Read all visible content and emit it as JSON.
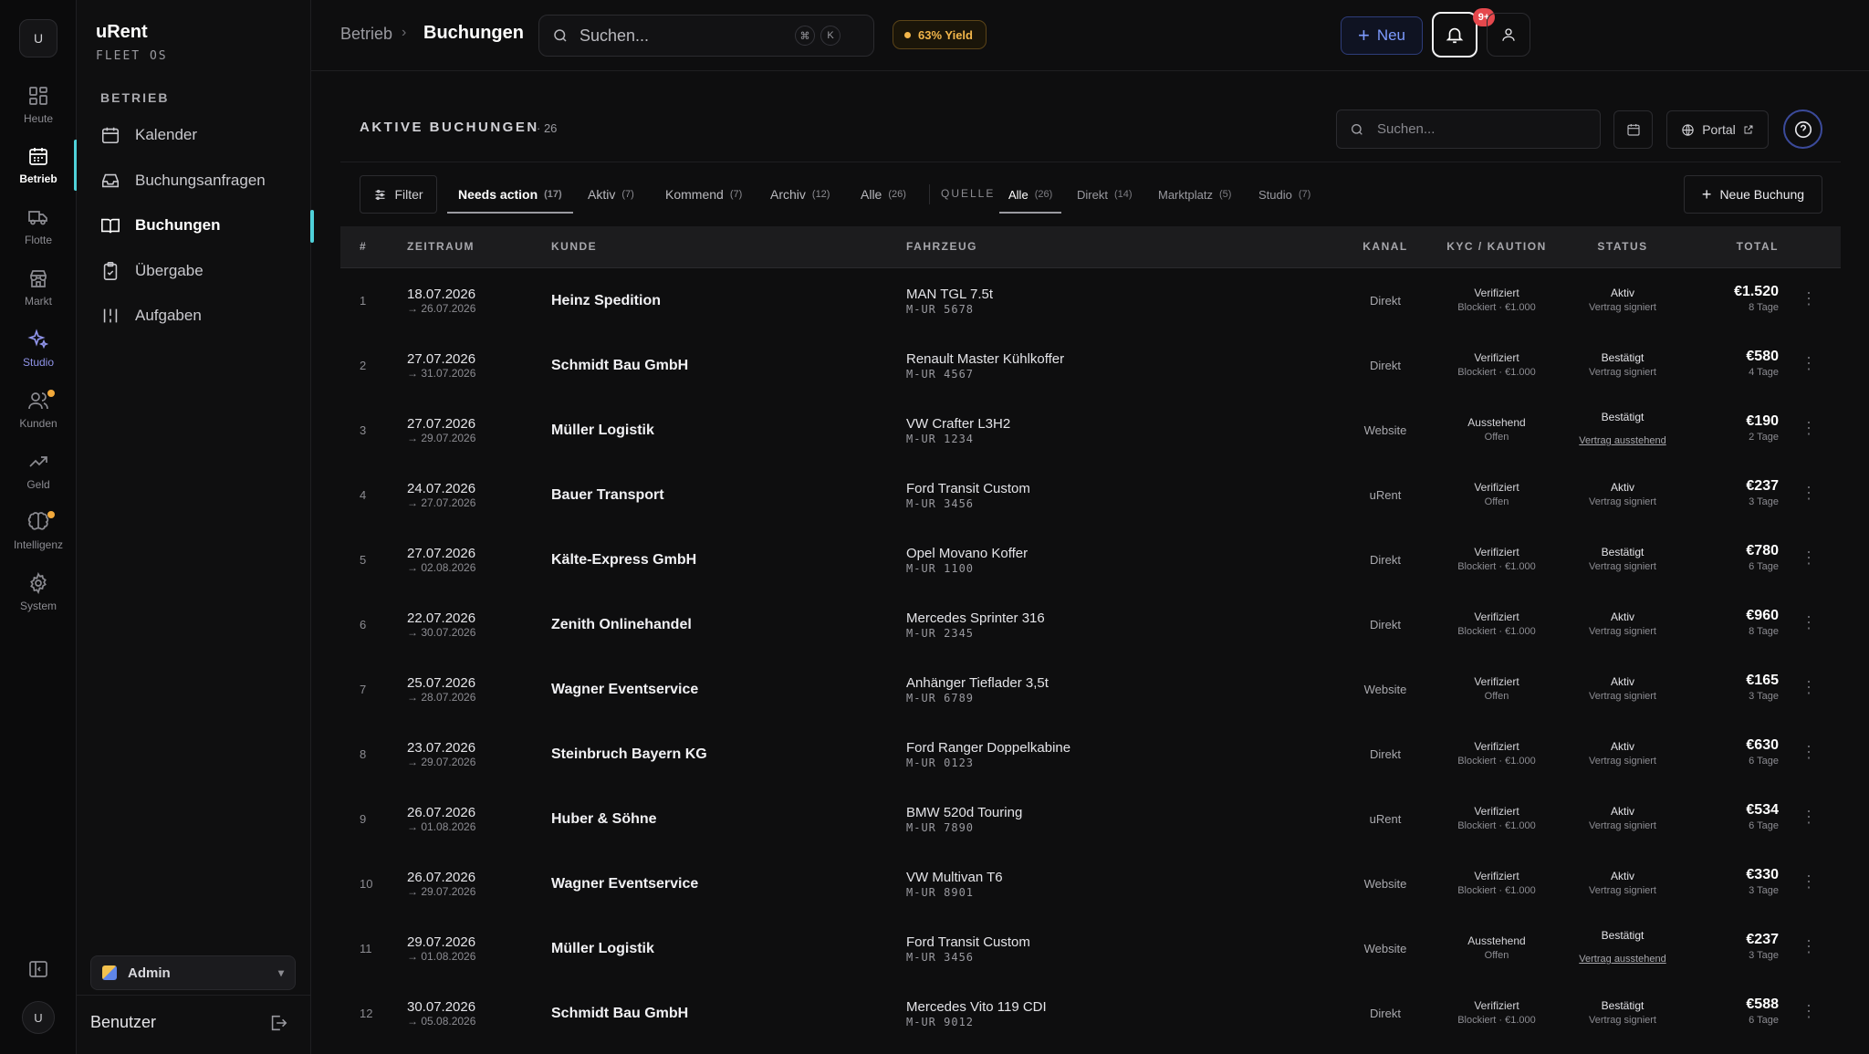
{
  "rail": {
    "top_avatar": "U",
    "items": [
      {
        "label": "Heute",
        "icon": "dashboard-icon"
      },
      {
        "label": "Betrieb",
        "icon": "calendar-icon"
      },
      {
        "label": "Flotte",
        "icon": "truck-icon"
      },
      {
        "label": "Markt",
        "icon": "store-icon"
      },
      {
        "label": "Studio",
        "icon": "sparkles-icon"
      },
      {
        "label": "Kunden",
        "icon": "users-icon"
      },
      {
        "label": "Geld",
        "icon": "trending-up-icon"
      },
      {
        "label": "Intelligenz",
        "icon": "brain-icon"
      },
      {
        "label": "System",
        "icon": "gear-icon"
      }
    ],
    "bottom_avatar": "U"
  },
  "sidebar": {
    "brand": "uRent",
    "brand_sub": "FLEET OS",
    "section": "BETRIEB",
    "items": [
      {
        "label": "Kalender"
      },
      {
        "label": "Buchungsanfragen"
      },
      {
        "label": "Buchungen"
      },
      {
        "label": "Übergabe"
      },
      {
        "label": "Aufgaben"
      }
    ],
    "role": "Admin",
    "user_label": "Benutzer"
  },
  "topbar": {
    "breadcrumb_parent": "Betrieb",
    "breadcrumb_current": "Buchungen",
    "search_placeholder": "Suchen...",
    "kbd1": "⌘",
    "kbd2": "K",
    "yield": "63% Yield",
    "new_label": "Neu",
    "notif_count": "9+"
  },
  "panel": {
    "title": "AKTIVE BUCHUNGEN",
    "count": "· 26",
    "search_placeholder": "Suchen...",
    "portal_label": "Portal"
  },
  "filters": {
    "filter_label": "Filter",
    "tabs": [
      {
        "label": "Needs action",
        "count": "(17)"
      },
      {
        "label": "Aktiv",
        "count": "(7)"
      },
      {
        "label": "Kommend",
        "count": "(7)"
      },
      {
        "label": "Archiv",
        "count": "(12)"
      },
      {
        "label": "Alle",
        "count": "(26)"
      }
    ],
    "source_label": "QUELLE",
    "sources": [
      {
        "label": "Alle",
        "count": "(26)"
      },
      {
        "label": "Direkt",
        "count": "(14)"
      },
      {
        "label": "Marktplatz",
        "count": "(5)"
      },
      {
        "label": "Studio",
        "count": "(7)"
      }
    ],
    "new_booking_label": "Neue Buchung"
  },
  "table": {
    "headers": [
      "#",
      "ZEITRAUM",
      "KUNDE",
      "FAHRZEUG",
      "KANAL",
      "KYC / KAUTION",
      "STATUS",
      "TOTAL"
    ],
    "rows": [
      {
        "num": "1",
        "from": "18.07.2026",
        "to": "→ 26.07.2026",
        "customer": "Heinz Spedition",
        "vehicle": "MAN TGL 7.5t",
        "plate": "M-UR 5678",
        "channel": "Direkt",
        "kyc": "Verifiziert",
        "deposit": "Blockiert · €1.000",
        "status": "Aktiv",
        "contract": "Vertrag signiert",
        "total": "€1.520",
        "days": "8 Tage"
      },
      {
        "num": "2",
        "from": "27.07.2026",
        "to": "→ 31.07.2026",
        "customer": "Schmidt Bau GmbH",
        "vehicle": "Renault Master Kühlkoffer",
        "plate": "M-UR 4567",
        "channel": "Direkt",
        "kyc": "Verifiziert",
        "deposit": "Blockiert · €1.000",
        "status": "Bestätigt",
        "contract": "Vertrag signiert",
        "total": "€580",
        "days": "4 Tage"
      },
      {
        "num": "3",
        "from": "27.07.2026",
        "to": "→ 29.07.2026",
        "customer": "Müller Logistik",
        "vehicle": "VW Crafter L3H2",
        "plate": "M-UR 1234",
        "channel": "Website",
        "kyc": "Ausstehend",
        "deposit": "Offen",
        "status": "Bestätigt",
        "contract": "Vertrag ausstehend",
        "total": "€190",
        "days": "2 Tage"
      },
      {
        "num": "4",
        "from": "24.07.2026",
        "to": "→ 27.07.2026",
        "customer": "Bauer Transport",
        "vehicle": "Ford Transit Custom",
        "plate": "M-UR 3456",
        "channel": "uRent",
        "kyc": "Verifiziert",
        "deposit": "Offen",
        "status": "Aktiv",
        "contract": "Vertrag signiert",
        "total": "€237",
        "days": "3 Tage"
      },
      {
        "num": "5",
        "from": "27.07.2026",
        "to": "→ 02.08.2026",
        "customer": "Kälte-Express GmbH",
        "vehicle": "Opel Movano Koffer",
        "plate": "M-UR 1100",
        "channel": "Direkt",
        "kyc": "Verifiziert",
        "deposit": "Blockiert · €1.000",
        "status": "Bestätigt",
        "contract": "Vertrag signiert",
        "total": "€780",
        "days": "6 Tage"
      },
      {
        "num": "6",
        "from": "22.07.2026",
        "to": "→ 30.07.2026",
        "customer": "Zenith Onlinehandel",
        "vehicle": "Mercedes Sprinter 316",
        "plate": "M-UR 2345",
        "channel": "Direkt",
        "kyc": "Verifiziert",
        "deposit": "Blockiert · €1.000",
        "status": "Aktiv",
        "contract": "Vertrag signiert",
        "total": "€960",
        "days": "8 Tage"
      },
      {
        "num": "7",
        "from": "25.07.2026",
        "to": "→ 28.07.2026",
        "customer": "Wagner Eventservice",
        "vehicle": "Anhänger Tieflader 3,5t",
        "plate": "M-UR 6789",
        "channel": "Website",
        "kyc": "Verifiziert",
        "deposit": "Offen",
        "status": "Aktiv",
        "contract": "Vertrag signiert",
        "total": "€165",
        "days": "3 Tage"
      },
      {
        "num": "8",
        "from": "23.07.2026",
        "to": "→ 29.07.2026",
        "customer": "Steinbruch Bayern KG",
        "vehicle": "Ford Ranger Doppelkabine",
        "plate": "M-UR 0123",
        "channel": "Direkt",
        "kyc": "Verifiziert",
        "deposit": "Blockiert · €1.000",
        "status": "Aktiv",
        "contract": "Vertrag signiert",
        "total": "€630",
        "days": "6 Tage"
      },
      {
        "num": "9",
        "from": "26.07.2026",
        "to": "→ 01.08.2026",
        "customer": "Huber & Söhne",
        "vehicle": "BMW 520d Touring",
        "plate": "M-UR 7890",
        "channel": "uRent",
        "kyc": "Verifiziert",
        "deposit": "Blockiert · €1.000",
        "status": "Aktiv",
        "contract": "Vertrag signiert",
        "total": "€534",
        "days": "6 Tage"
      },
      {
        "num": "10",
        "from": "26.07.2026",
        "to": "→ 29.07.2026",
        "customer": "Wagner Eventservice",
        "vehicle": "VW Multivan T6",
        "plate": "M-UR 8901",
        "channel": "Website",
        "kyc": "Verifiziert",
        "deposit": "Blockiert · €1.000",
        "status": "Aktiv",
        "contract": "Vertrag signiert",
        "total": "€330",
        "days": "3 Tage"
      },
      {
        "num": "11",
        "from": "29.07.2026",
        "to": "→ 01.08.2026",
        "customer": "Müller Logistik",
        "vehicle": "Ford Transit Custom",
        "plate": "M-UR 3456",
        "channel": "Website",
        "kyc": "Ausstehend",
        "deposit": "Offen",
        "status": "Bestätigt",
        "contract": "Vertrag ausstehend",
        "total": "€237",
        "days": "3 Tage"
      },
      {
        "num": "12",
        "from": "30.07.2026",
        "to": "→ 05.08.2026",
        "customer": "Schmidt Bau GmbH",
        "vehicle": "Mercedes Vito 119 CDI",
        "plate": "M-UR 9012",
        "channel": "Direkt",
        "kyc": "Verifiziert",
        "deposit": "Blockiert · €1.000",
        "status": "Bestätigt",
        "contract": "Vertrag signiert",
        "total": "€588",
        "days": "6 Tage"
      }
    ]
  },
  "colors": {
    "accent_teal": "#4fd1d9",
    "accent_blue": "#7d9bff",
    "yield_amber": "#f2b64a",
    "badge_red": "#e5484d",
    "background": "#0e0e0f"
  }
}
